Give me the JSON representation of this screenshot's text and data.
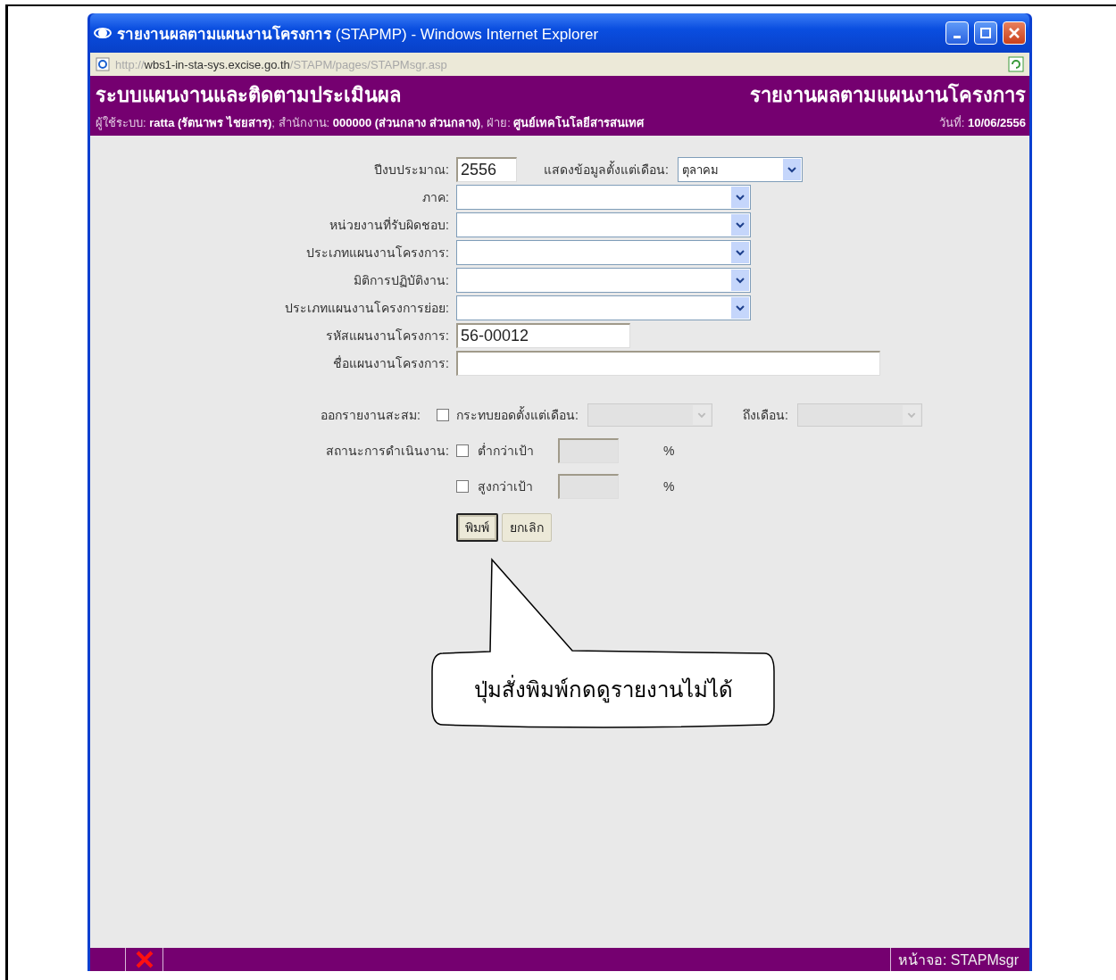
{
  "window": {
    "title": "**รายงานผลตามแผนงานโครงการ** (STAPMP) - Windows Internet Explorer",
    "address": "http://**wbs1-in-sta-sys.excise.go.th**/STAPM/pages/STAPMsgr.asp"
  },
  "header": {
    "system_title": "ระบบแผนงานและติดตามประเมินผล",
    "report_title": "รายงานผลตามแผนงานโครงการ",
    "user_info": "ผู้ใช้ระบบ: **ratta (รัตนาพร ไชยสาร)**; สำนักงาน: **000000 (ส่วนกลาง ส่วนกลาง)**, ฝ่าย: **ศูนย์เทคโนโลยีสารสนเทศ**",
    "date_label": "วันที่:",
    "date": "10/06/2556"
  },
  "form": {
    "budget_year": {
      "label": "ปีงบประมาณ:",
      "value": "2556"
    },
    "start_month": {
      "label": "แสดงข้อมูลตั้งแต่เดือน:",
      "value": "ตุลาคม"
    },
    "fields": [
      {
        "kind": "select",
        "label": "ภาค:"
      },
      {
        "kind": "select",
        "label": "หน่วยงานที่รับผิดชอบ:"
      },
      {
        "kind": "select",
        "label": "ประเภทแผนงานโครงการ:"
      },
      {
        "kind": "select",
        "label": "มิติการปฏิบัติงาน:"
      },
      {
        "kind": "select",
        "label": "ประเภทแผนงานโครงการย่อย:"
      },
      {
        "kind": "code",
        "label": "รหัสแผนงานโครงการ:",
        "value": "56-00012"
      },
      {
        "kind": "name",
        "label": "ชื่อแผนงานโครงการ:"
      }
    ],
    "accumulate": {
      "label": "ออกรายงานสะสม:",
      "checked": false,
      "from_label": "กระทบยอดตั้งแต่เดือน:",
      "from_disabled": true,
      "to_label": "ถึงเดือน:",
      "to_disabled": true
    },
    "status": {
      "label": "สถานะการดำเนินงาน:",
      "options": [
        {
          "label": "ต่ำกว่าเป้า",
          "checked": false,
          "unit": "%"
        },
        {
          "label": "สูงกว่าเป้า",
          "checked": false,
          "unit": "%"
        }
      ]
    },
    "buttons": [
      {
        "label": "พิมพ์",
        "focused": true
      },
      {
        "label": "ยกเลิก",
        "focused": false
      }
    ]
  },
  "callout": {
    "text": "ปุ่มสั่งพิมพ์กดดูรายงานไม่ได้"
  },
  "status_bar": {
    "page": "หน้าจอ: STAPMsgr"
  }
}
